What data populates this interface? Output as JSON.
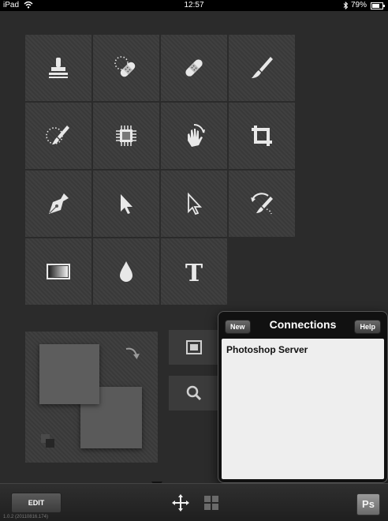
{
  "status_bar": {
    "device": "iPad",
    "time": "12:57",
    "battery_percent": "79%",
    "icons": [
      "wifi-icon",
      "bluetooth-icon",
      "battery-icon"
    ]
  },
  "tools": [
    {
      "name": "stamp-tool",
      "icon": "clone-stamp-icon"
    },
    {
      "name": "spot-healing-tool",
      "icon": "spot-healing-bandage-icon"
    },
    {
      "name": "healing-brush-tool",
      "icon": "bandage-icon"
    },
    {
      "name": "brush-tool",
      "icon": "paint-brush-icon"
    },
    {
      "name": "selection-brush-tool",
      "icon": "selection-brush-icon"
    },
    {
      "name": "smart-object-tool",
      "icon": "chip-icon"
    },
    {
      "name": "smudge-tool",
      "icon": "smudge-hand-icon"
    },
    {
      "name": "crop-tool",
      "icon": "crop-icon"
    },
    {
      "name": "pen-tool",
      "icon": "pen-nib-icon"
    },
    {
      "name": "path-selection-tool",
      "icon": "arrow-cursor-icon"
    },
    {
      "name": "direct-selection-tool",
      "icon": "hollow-arrow-cursor-icon"
    },
    {
      "name": "history-brush-tool",
      "icon": "history-brush-icon"
    },
    {
      "name": "gradient-tool",
      "icon": "gradient-icon"
    },
    {
      "name": "blur-tool",
      "icon": "drop-icon"
    },
    {
      "name": "type-tool",
      "icon": "type-icon"
    }
  ],
  "colors": {
    "background": "#2b2b2b",
    "tile": "#3b3b3b",
    "foreground_swatch": "#5d5d5d",
    "background_swatch": "#5a5a5a",
    "icon": "#e8e8e8"
  },
  "popover": {
    "title": "Connections",
    "new_label": "New",
    "help_label": "Help",
    "connections": [
      "Photoshop Server"
    ]
  },
  "bottom_bar": {
    "edit_label": "EDIT",
    "version": "1.0.2 (20110816.174)",
    "ps_label": "Ps"
  }
}
